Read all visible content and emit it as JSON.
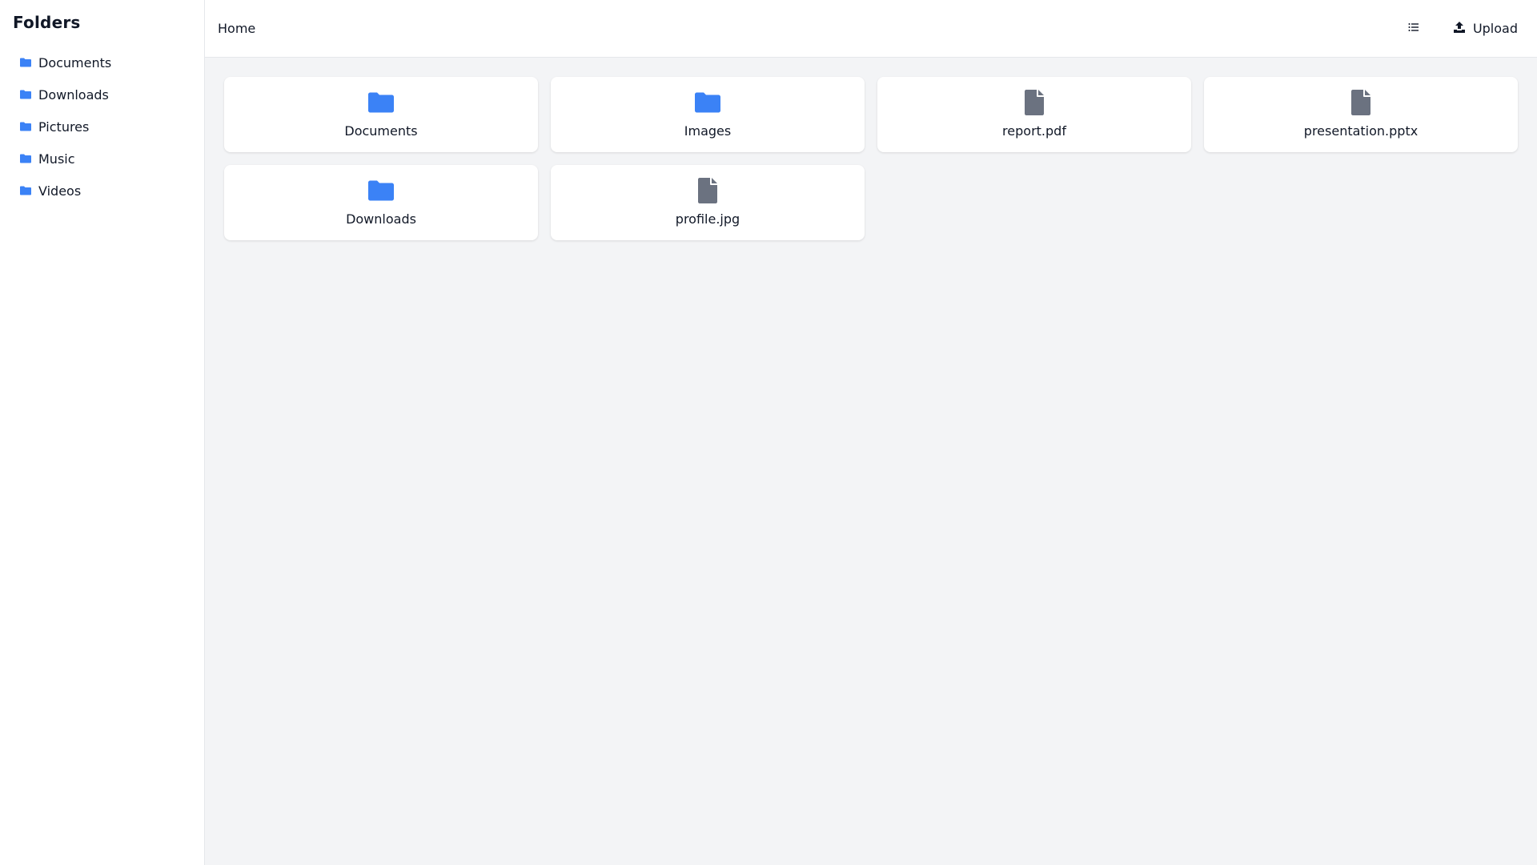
{
  "colors": {
    "folder": "#3b82f6",
    "file": "#6b7280",
    "background": "#f3f4f6",
    "surface": "#ffffff",
    "text": "#111827"
  },
  "sidebar": {
    "title": "Folders",
    "items": [
      {
        "label": "Documents",
        "icon": "folder-icon"
      },
      {
        "label": "Downloads",
        "icon": "folder-icon"
      },
      {
        "label": "Pictures",
        "icon": "folder-icon"
      },
      {
        "label": "Music",
        "icon": "folder-icon"
      },
      {
        "label": "Videos",
        "icon": "folder-icon"
      }
    ]
  },
  "header": {
    "breadcrumb": "Home",
    "view_toggle_icon": "list-icon",
    "upload_label": "Upload",
    "upload_icon": "upload-icon"
  },
  "main": {
    "items": [
      {
        "label": "Documents",
        "type": "folder"
      },
      {
        "label": "Images",
        "type": "folder"
      },
      {
        "label": "report.pdf",
        "type": "file"
      },
      {
        "label": "presentation.pptx",
        "type": "file"
      },
      {
        "label": "Downloads",
        "type": "folder"
      },
      {
        "label": "profile.jpg",
        "type": "file"
      }
    ]
  }
}
